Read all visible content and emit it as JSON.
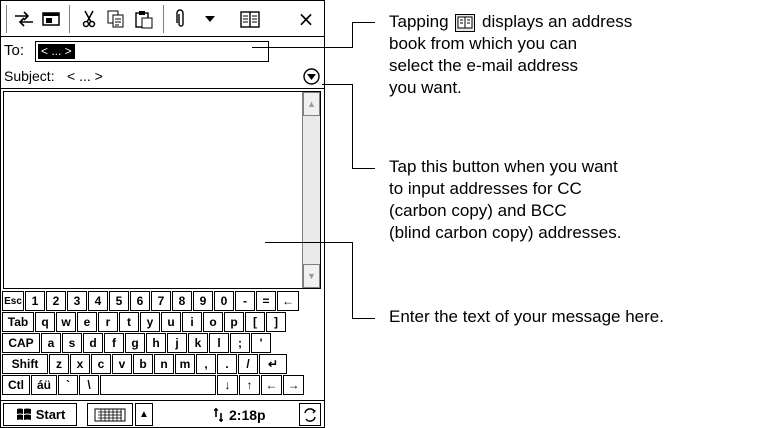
{
  "compose": {
    "to_label": "To:",
    "to_value": "< ... >",
    "subject_label": "Subject:",
    "subject_value": "< ... >"
  },
  "toolbar": {
    "icons": [
      "send-icon",
      "view-icon",
      "cut-icon",
      "copy-icon",
      "paste-icon",
      "attach-icon",
      "dropdown-icon",
      "address-book-icon",
      "close-icon"
    ],
    "close_label": "×"
  },
  "keyboard": {
    "rows": [
      [
        "Esc",
        "1",
        "2",
        "3",
        "4",
        "5",
        "6",
        "7",
        "8",
        "9",
        "0",
        "-",
        "=",
        "←"
      ],
      [
        "Tab",
        "q",
        "w",
        "e",
        "r",
        "t",
        "y",
        "u",
        "i",
        "o",
        "p",
        "[",
        "]"
      ],
      [
        "CAP",
        "a",
        "s",
        "d",
        "f",
        "g",
        "h",
        "j",
        "k",
        "l",
        ";",
        "'"
      ],
      [
        "Shift",
        "z",
        "x",
        "c",
        "v",
        "b",
        "n",
        "m",
        ",",
        ".",
        "/",
        "↵"
      ],
      [
        "Ctl",
        "áü",
        "`",
        "\\",
        "",
        "↓",
        "↑",
        "←",
        "→"
      ]
    ]
  },
  "taskbar": {
    "start_label": "Start",
    "time": "2:18p"
  },
  "annotations": {
    "address_book_pre": "Tapping",
    "address_book_post": "displays an address",
    "address_book_line2": "book from which you can",
    "address_book_line3": "select the e-mail address",
    "address_book_line4": "you want.",
    "cc_line1": "Tap this button when you want",
    "cc_line2": "to input addresses for CC",
    "cc_line3": "(carbon copy) and BCC",
    "cc_line4": "(blind carbon copy) addresses.",
    "body_text": "Enter the text of your message here."
  }
}
